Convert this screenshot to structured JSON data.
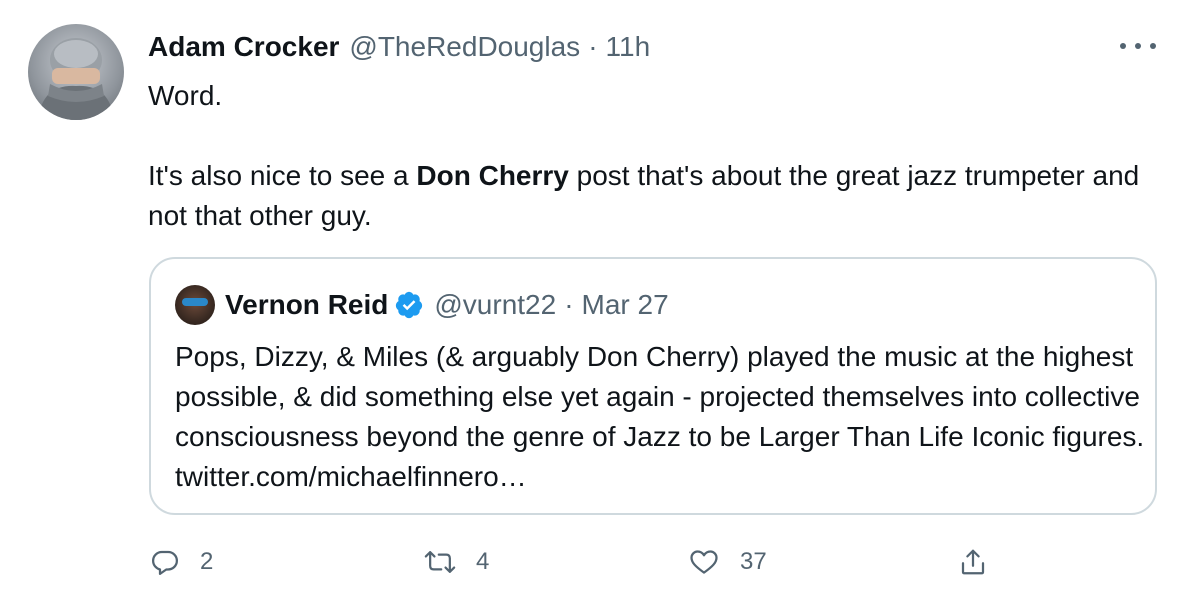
{
  "tweet": {
    "author_name": "Adam Crocker",
    "author_handle": "@TheRedDouglas",
    "separator": "·",
    "timestamp": "11h",
    "text_line1": "Word.",
    "text_p2_before": "It's also nice to see a ",
    "text_p2_bold": "Don Cherry",
    "text_p2_after": " post that's about the great jazz trumpeter and not that other guy."
  },
  "quoted": {
    "author_name": "Vernon Reid",
    "author_handle": "@vurnt22",
    "separator": "·",
    "timestamp": "Mar 27",
    "verified": true,
    "text": "Pops, Dizzy, & Miles (& arguably Don Cherry) played the music at the highest possible, & did something else yet again - projected themselves into collective consciousness beyond the genre of Jazz to be Larger Than Life Iconic figures. twitter.com/michaelfinnero…"
  },
  "actions": {
    "reply_count": "2",
    "retweet_count": "4",
    "like_count": "37"
  },
  "colors": {
    "text": "#0f1419",
    "secondary": "#536471",
    "border": "#cfd9de",
    "verified": "#1d9bf0"
  },
  "icons": [
    "more-icon",
    "verified-icon",
    "reply-icon",
    "retweet-icon",
    "like-icon",
    "share-icon"
  ]
}
